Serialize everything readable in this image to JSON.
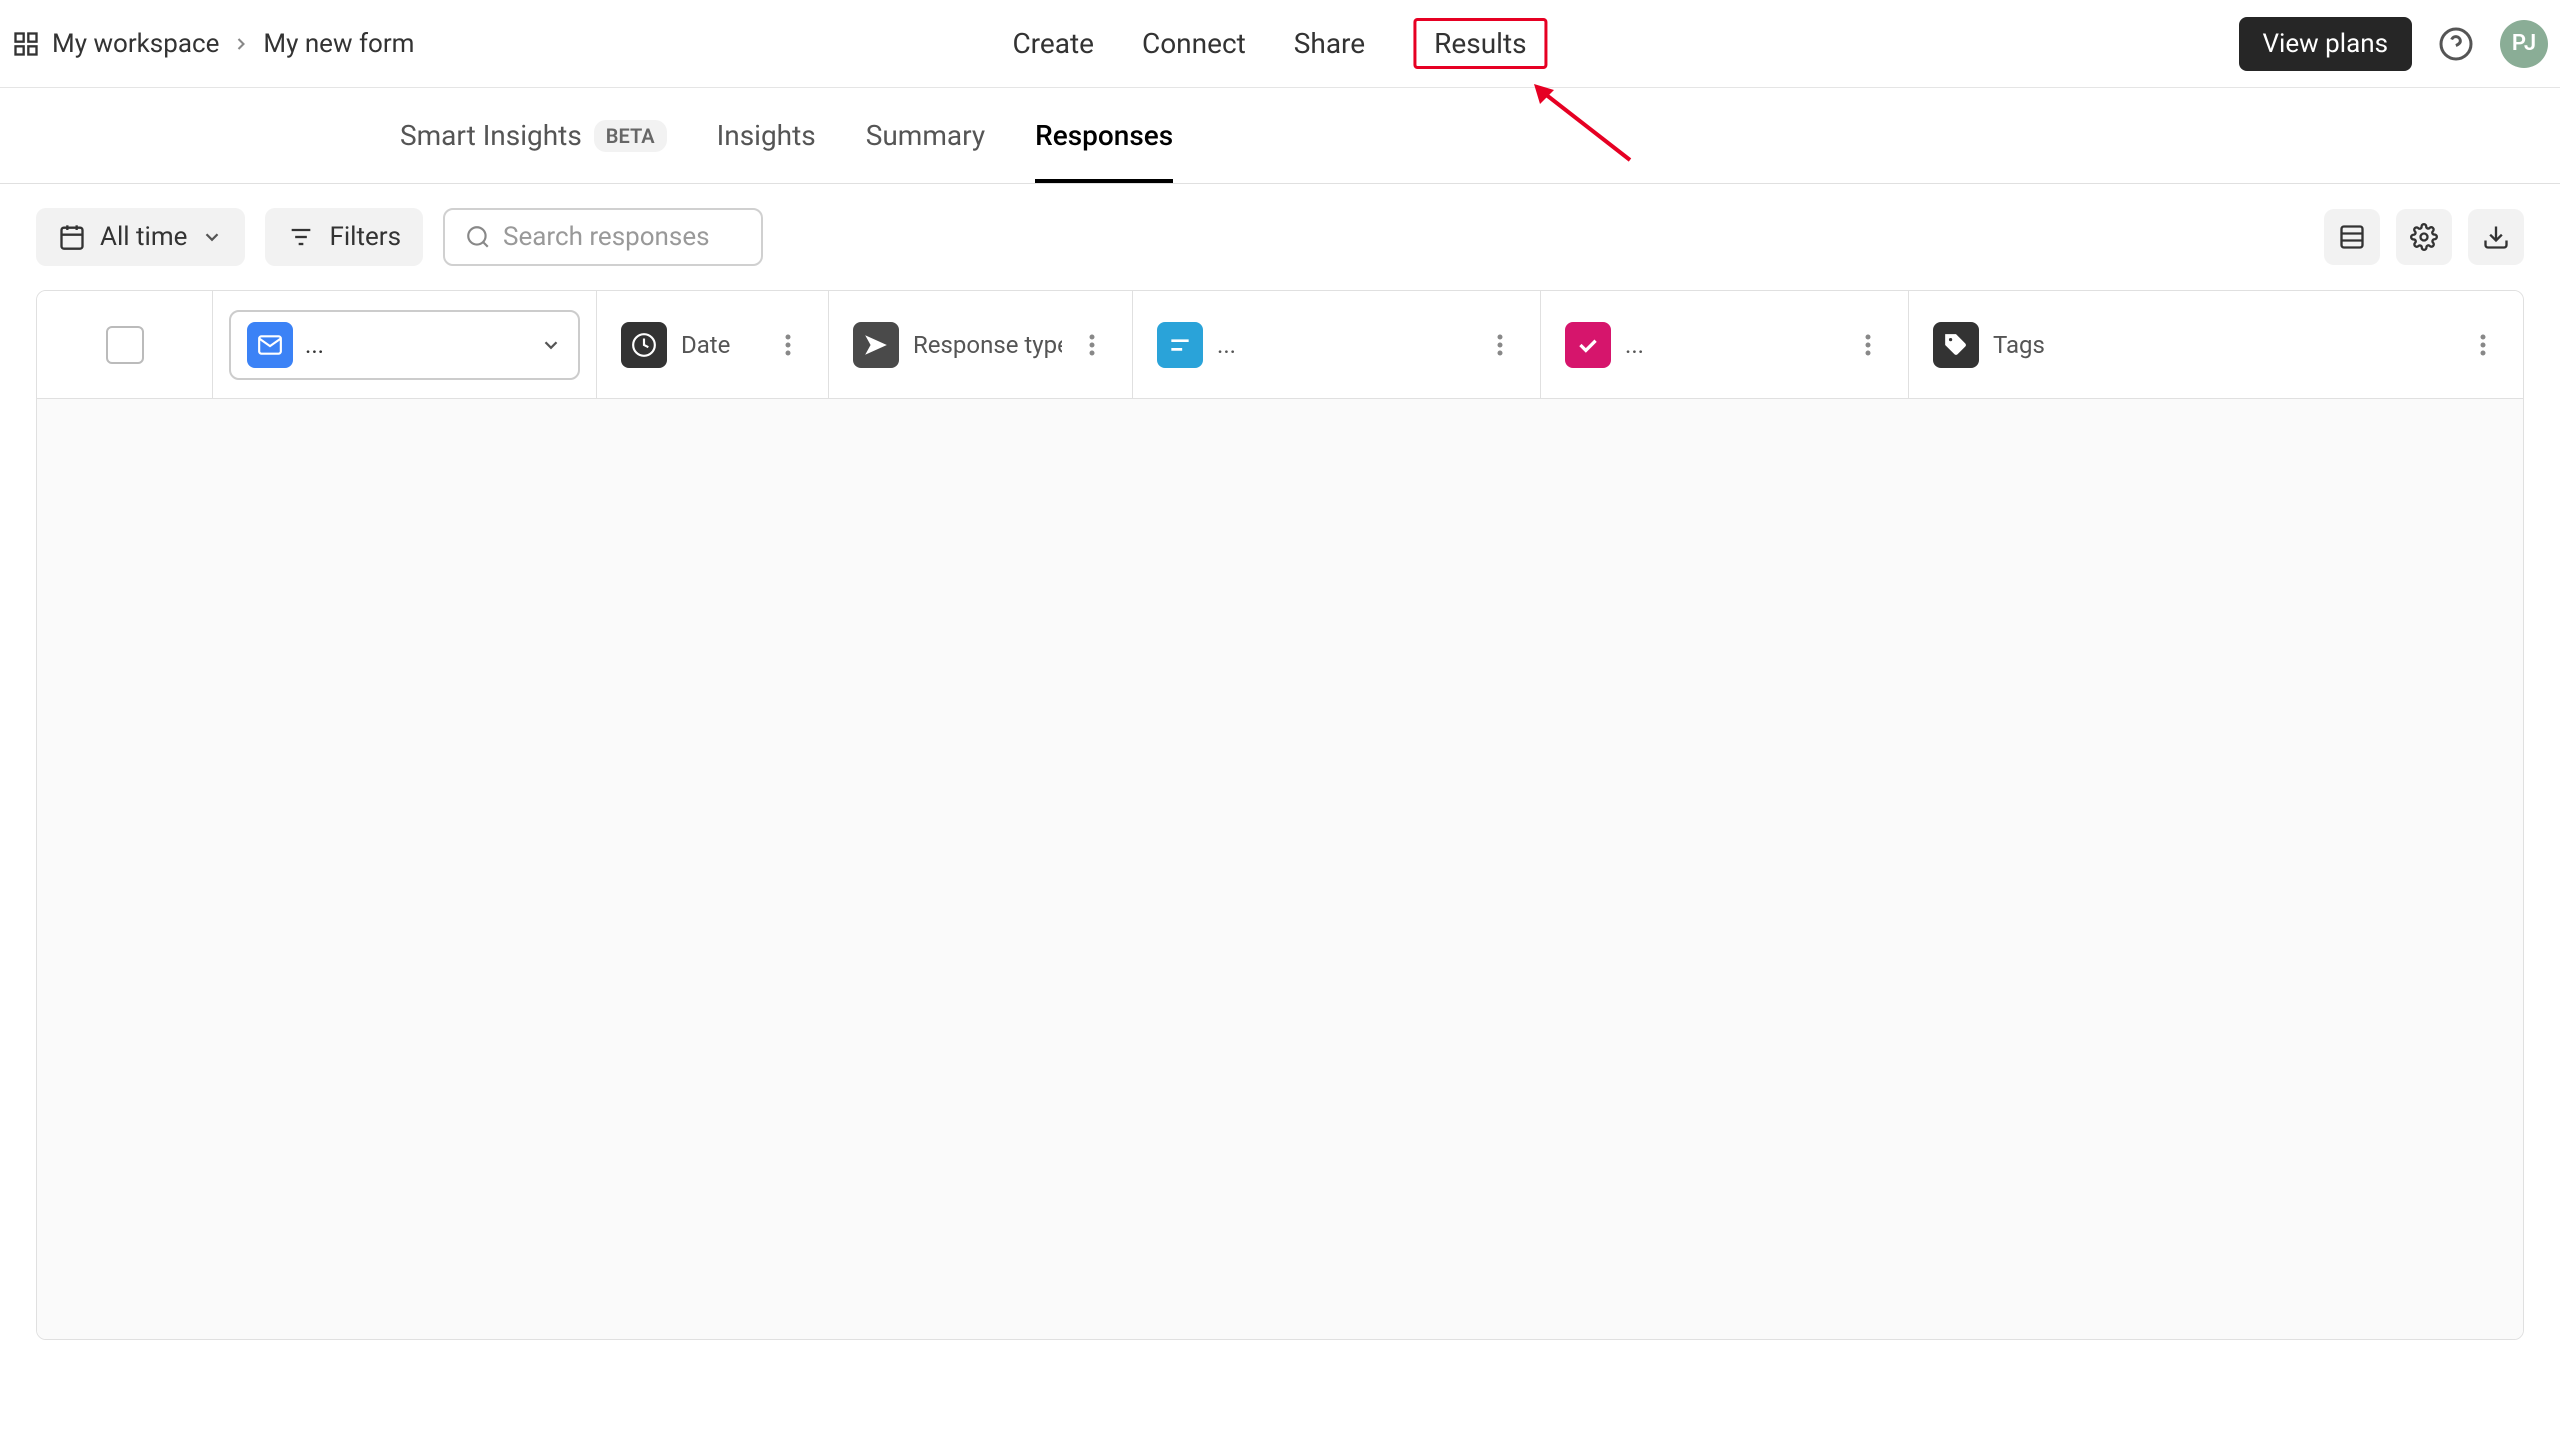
{
  "breadcrumb": {
    "workspace": "My workspace",
    "form": "My new form"
  },
  "topnav": {
    "create": "Create",
    "connect": "Connect",
    "share": "Share",
    "results": "Results"
  },
  "topright": {
    "view_plans": "View plans",
    "avatar_initials": "PJ"
  },
  "subnav": {
    "smart_insights": "Smart Insights",
    "beta": "BETA",
    "insights": "Insights",
    "summary": "Summary",
    "responses": "Responses"
  },
  "toolbar": {
    "all_time": "All time",
    "filters": "Filters",
    "search_placeholder": "Search responses"
  },
  "columns": {
    "dropdown_text": "...",
    "date": "Date",
    "response_type": "Response type",
    "q1_text": "...",
    "q2_text": "...",
    "tags": "Tags"
  },
  "colors": {
    "email_icon_bg": "#3b82f6",
    "date_icon_bg": "#333333",
    "send_icon_bg": "#4a4a4a",
    "question_icon_bg": "#2aa3d9",
    "check_icon_bg": "#d6156c",
    "tag_icon_bg": "#333333"
  }
}
